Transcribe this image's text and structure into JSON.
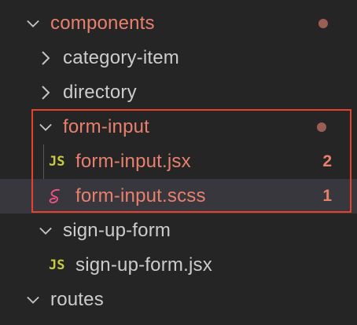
{
  "explorer": {
    "items": [
      {
        "label": "components",
        "kind": "folder",
        "expanded": true,
        "modified": true,
        "has_dot": true
      },
      {
        "label": "category-item",
        "kind": "folder",
        "expanded": false,
        "modified": false
      },
      {
        "label": "directory",
        "kind": "folder",
        "expanded": false,
        "modified": false
      },
      {
        "label": "form-input",
        "kind": "folder",
        "expanded": true,
        "modified": true,
        "has_dot": true
      },
      {
        "label": "form-input.jsx",
        "kind": "file",
        "icon": "JS",
        "icon_name": "javascript-icon",
        "modified": true,
        "problems": "2"
      },
      {
        "label": "form-input.scss",
        "kind": "file",
        "icon_name": "sass-icon",
        "modified": true,
        "problems": "1",
        "selected": true
      },
      {
        "label": "sign-up-form",
        "kind": "folder",
        "expanded": true,
        "modified": false
      },
      {
        "label": "sign-up-form.jsx",
        "kind": "file",
        "icon": "JS",
        "icon_name": "javascript-icon",
        "modified": false
      },
      {
        "label": "routes",
        "kind": "folder",
        "expanded": true,
        "modified": false
      }
    ]
  },
  "colors": {
    "background": "#252526",
    "modified_text": "#e9806e",
    "normal_text": "#cccccc",
    "highlight_border": "#e8412c",
    "js_icon": "#cbcb41",
    "sass_icon": "#f55385"
  }
}
